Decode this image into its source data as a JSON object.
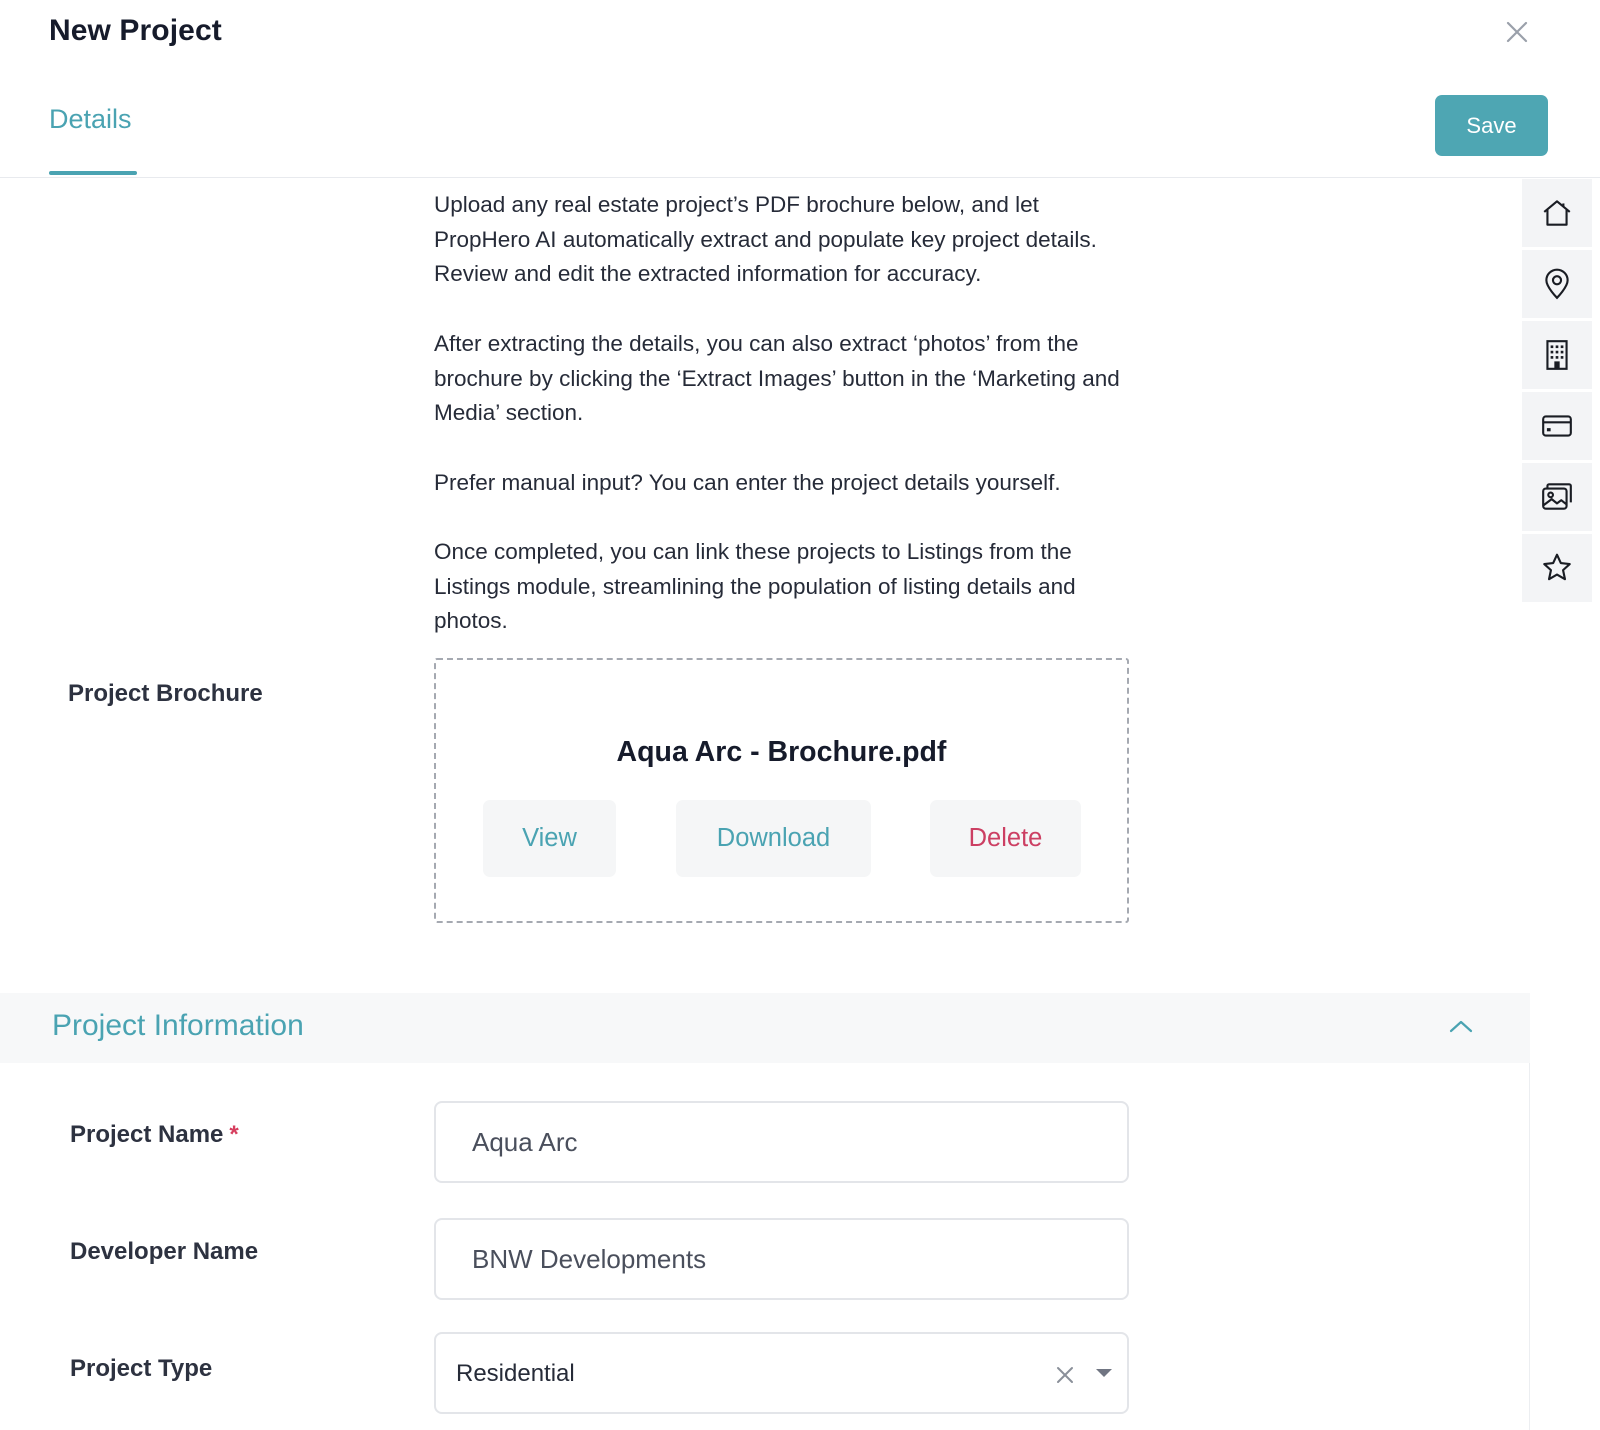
{
  "header": {
    "title": "New Project",
    "close_icon": "close-icon"
  },
  "tabs": [
    {
      "label": "Details",
      "active": true
    }
  ],
  "toolbar": {
    "save_label": "Save"
  },
  "side_rail": [
    {
      "icon": "home-icon"
    },
    {
      "icon": "location-pin-icon"
    },
    {
      "icon": "building-icon"
    },
    {
      "icon": "credit-card-icon"
    },
    {
      "icon": "gallery-icon"
    },
    {
      "icon": "star-icon"
    }
  ],
  "intro": {
    "p1": "Upload any real estate project’s PDF brochure below, and let PropHero AI automatically extract and populate key project details. Review and edit the extracted information for accuracy.",
    "p2": "After extracting the details, you can also extract ‘photos’ from the brochure by clicking the ‘Extract Images’ button in the ‘Marketing and Media’ section.",
    "p3": "Prefer manual input? You can enter the project details yourself.",
    "p4": "Once completed, you can link these projects to Listings from the Listings module, streamlining the population of listing details and photos."
  },
  "brochure": {
    "label": "Project Brochure",
    "file_name": "Aqua Arc - Brochure.pdf",
    "view_label": "View",
    "download_label": "Download",
    "delete_label": "Delete"
  },
  "section": {
    "title": "Project Information",
    "expanded": true
  },
  "fields": {
    "project_name": {
      "label": "Project Name",
      "required_mark": "*",
      "value": "Aqua Arc"
    },
    "developer_name": {
      "label": "Developer Name",
      "value": "BNW Developments"
    },
    "project_type": {
      "label": "Project Type",
      "value": "Residential"
    }
  },
  "colors": {
    "accent": "#4aa3b2",
    "save_bg": "#4ea6b3",
    "danger": "#cc3f63",
    "required": "#d63e5e"
  }
}
